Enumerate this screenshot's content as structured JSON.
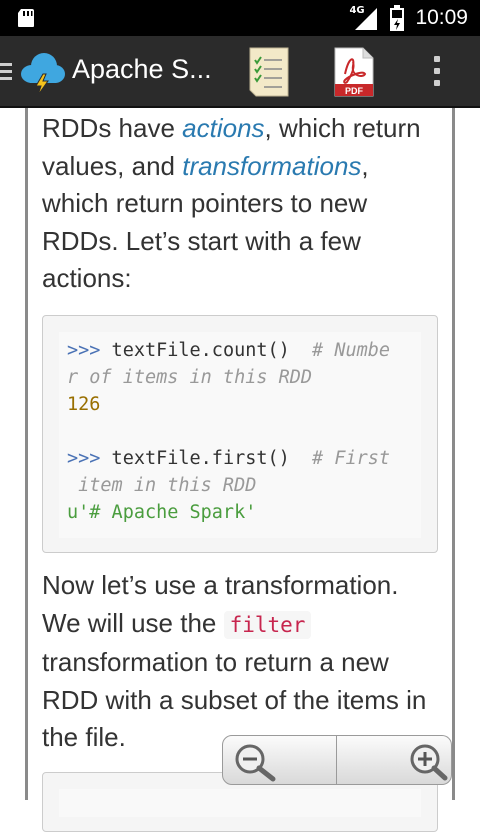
{
  "status_bar": {
    "network": "4G",
    "time": "10:09"
  },
  "app": {
    "title": "Apache S..."
  },
  "content": {
    "p1": {
      "t1": "RDDs have ",
      "em1": "actions",
      "t2": ", which return values, and ",
      "em2": "transformations",
      "t3": ", which return pointers to new RDDs. Let’s start with a few actions:"
    },
    "code1": {
      "lines": [
        {
          "prompt": ">>>",
          "code": " textFile.count()",
          "comment": "  # Numbe"
        },
        {
          "comment": "r of items in this RDD"
        },
        {
          "output": "126"
        },
        {
          "prompt": ">>>",
          "code": " textFile.first()",
          "comment": "  # First"
        },
        {
          "comment": " item in this RDD"
        },
        {
          "output": "u'# Apache Spark'"
        }
      ]
    },
    "p2": {
      "t1": "Now let’s use a transformation. We will use the ",
      "code": "filter",
      "t2": " transformation to return a new RDD with a subset of the items in the file."
    }
  },
  "colors": {
    "link": "#2a7ab0",
    "inline_code": "#c7254e",
    "prompt": "#4a72b5",
    "comment": "#999999",
    "number": "#996f00",
    "string": "#4a9d3e"
  }
}
